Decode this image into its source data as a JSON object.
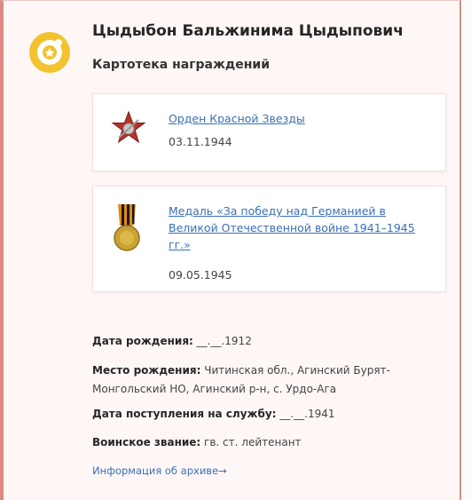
{
  "person": {
    "name": "Цыдыбон Бальжинима Цыдыпович",
    "section_title": "Картотека награждений"
  },
  "awards": [
    {
      "title": "Орден Красной Звезды",
      "date": "03.11.1944",
      "icon": "red-star-order-icon"
    },
    {
      "title": "Медаль «За победу над Германией в Великой Отечественной войне 1941–1945 гг.»",
      "date": "09.05.1945",
      "icon": "victory-medal-icon"
    }
  ],
  "details": {
    "birth_date_label": "Дата рождения:",
    "birth_date_value": "__.__.1912",
    "birth_place_label": "Место рождения:",
    "birth_place_value": "Читинская обл., Агинский Бурят-Монгольский НО, Агинский р-н, с. Урдо-Ага",
    "service_date_label": "Дата поступления на службу:",
    "service_date_value": "__.__.1941",
    "rank_label": "Воинское звание:",
    "rank_value": "гв. ст. лейтенант"
  },
  "archive_link": "Информация об архиве→",
  "colors": {
    "accent_gold": "#f2c230",
    "link_blue": "#3a6fb5",
    "card_border": "#d98c86"
  }
}
